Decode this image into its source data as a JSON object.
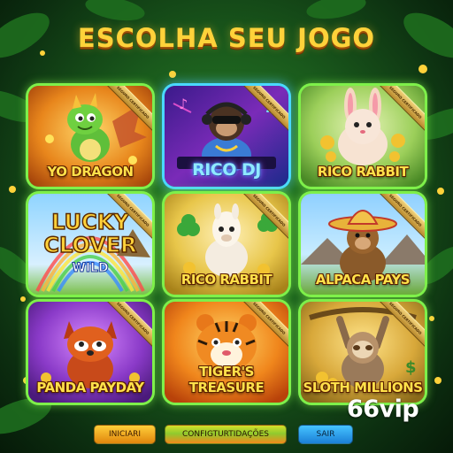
{
  "header": {
    "title": "ESCOLHA SEU JOGO"
  },
  "games": [
    {
      "label": "YO DRAGON",
      "ribbon": "SEGURO CERTIFICADO"
    },
    {
      "label": "RICO DJ",
      "ribbon": "SEGURO CERTIFICADO"
    },
    {
      "label": "RICO RABBIT",
      "ribbon": "SEGURO CERTIFICADO"
    },
    {
      "label": "LUCKY CLOVER WILD",
      "ribbon": "SEGURO CERTIFICADO",
      "art_text": {
        "line1": "LUCKY",
        "line2": "CLOVER",
        "line3": "WILD"
      }
    },
    {
      "label": "RICO RABBIT",
      "ribbon": "SEGURO CERTIFICADO"
    },
    {
      "label": "ALPACA PAYS",
      "ribbon": "SEGURO CERTIFICADO"
    },
    {
      "label": "PANDA PAYDAY",
      "ribbon": "SEGURO CERTIFICADO"
    },
    {
      "label": "TIGER'S TREASURE",
      "ribbon": "SEGURO CERTIFICADO"
    },
    {
      "label": "SLOTH MILLIONS",
      "ribbon": "SEGURO CERTIFICADO"
    }
  ],
  "buttons": {
    "start": "INICIARI",
    "settings": "CONFIGTURTIDAÇÕES",
    "exit": "SAIR"
  },
  "brand": "66vip",
  "colors": {
    "title": "#ffd23a",
    "tile_glow": "#7ef04a",
    "dj_glow": "#4ad8ff"
  }
}
